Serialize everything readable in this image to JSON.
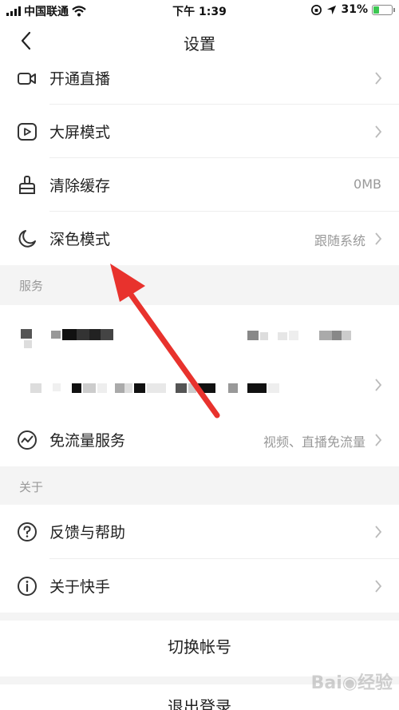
{
  "status_bar": {
    "carrier": "中国联通",
    "time": "下午 1:39",
    "battery_percent": "31%",
    "battery_level": 0.31
  },
  "nav": {
    "title": "设置"
  },
  "rows_top": [
    {
      "label": "开通直播",
      "value": "",
      "icon": "video-camera-icon"
    },
    {
      "label": "大屏模式",
      "value": "",
      "icon": "play-screen-icon"
    },
    {
      "label": "清除缓存",
      "value": "0MB",
      "icon": "broom-icon"
    },
    {
      "label": "深色模式",
      "value": "跟随系统",
      "icon": "moon-icon"
    }
  ],
  "services": {
    "header": "服务",
    "free_data": {
      "label": "免流量服务",
      "value": "视频、直播免流量",
      "icon": "trend-icon"
    }
  },
  "about": {
    "header": "关于",
    "items": [
      {
        "label": "反馈与帮助",
        "icon": "question-icon"
      },
      {
        "label": "关于快手",
        "icon": "info-icon"
      }
    ]
  },
  "actions": {
    "switch_account": "切换帐号",
    "logout": "退出登录"
  },
  "colors": {
    "annotation_arrow": "#e8322d",
    "section_bg": "#f4f4f4",
    "battery_fill": "#3cc752"
  }
}
